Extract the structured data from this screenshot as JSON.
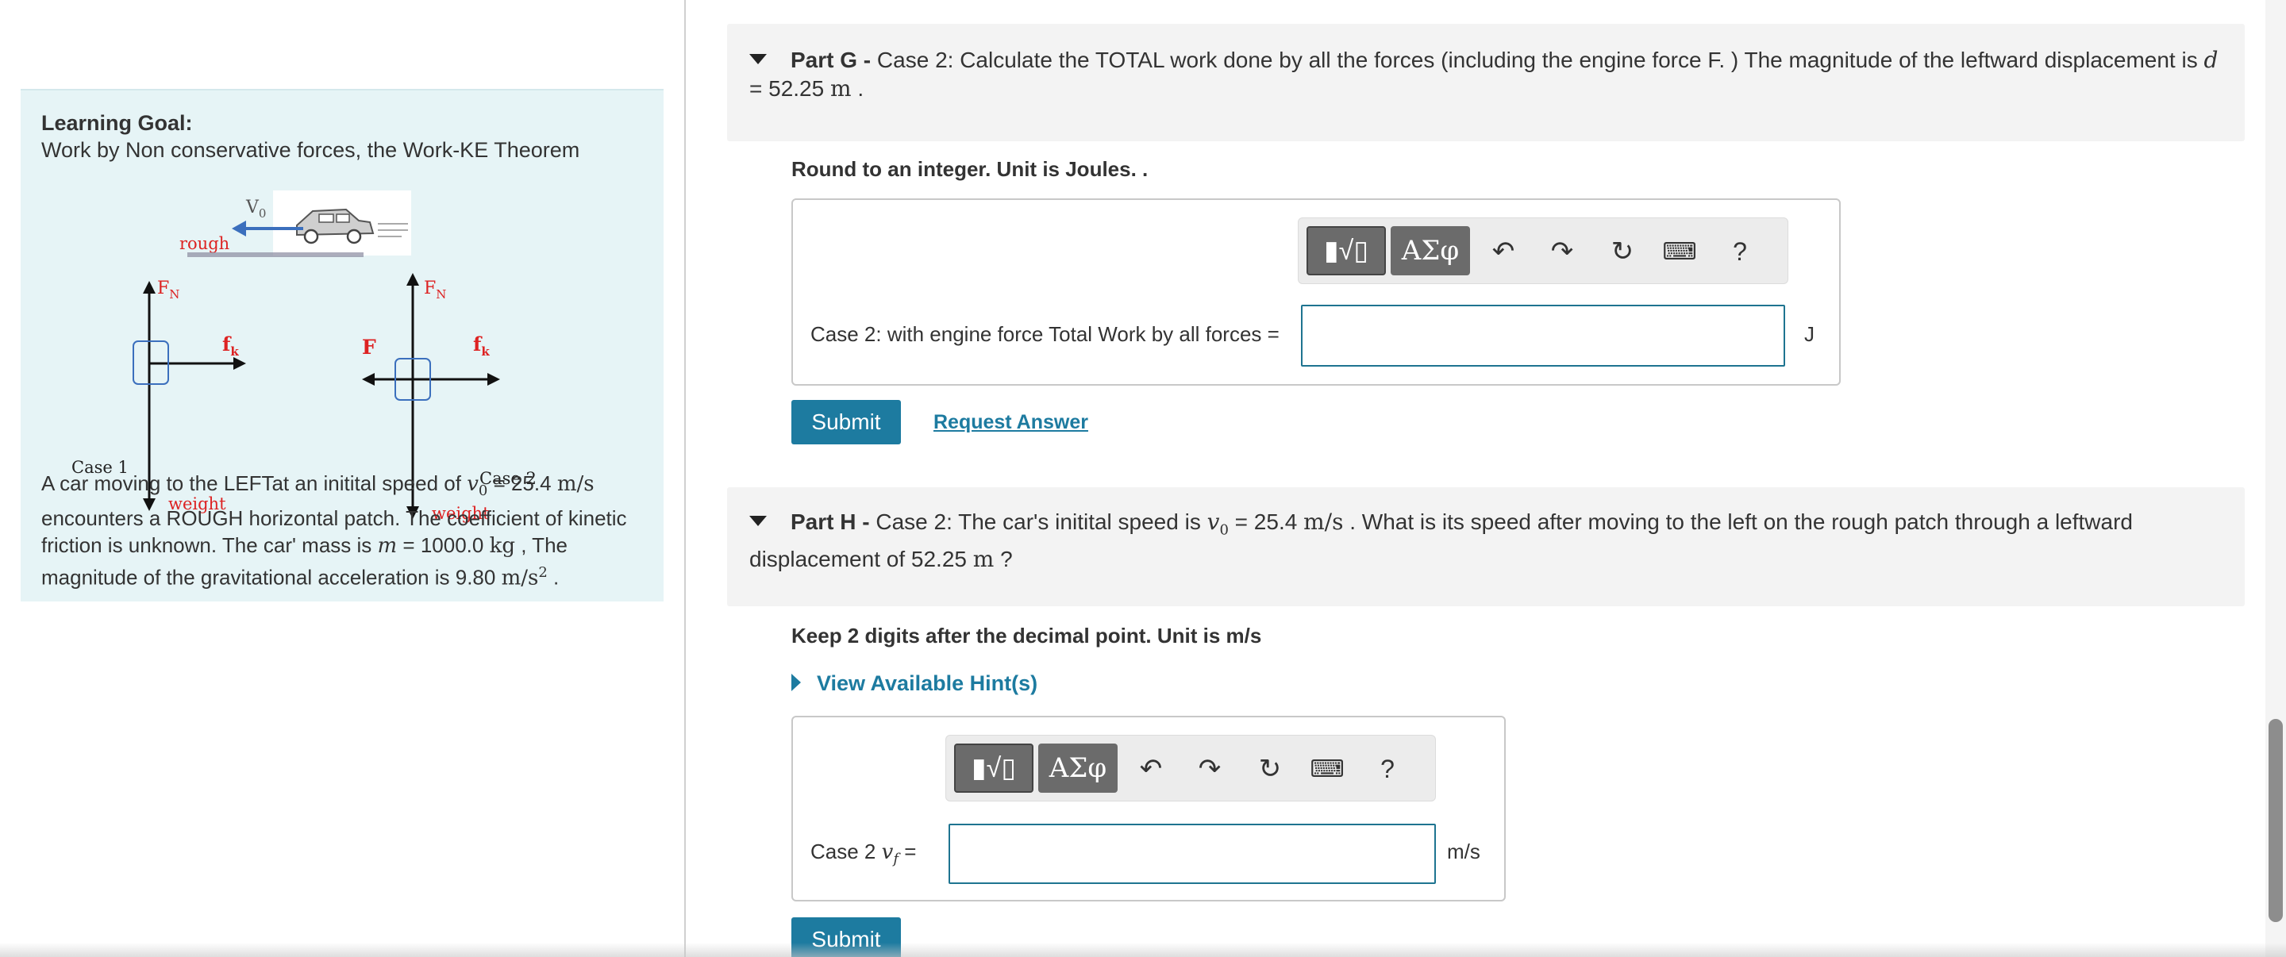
{
  "learning_goal": {
    "title": "Learning Goal:",
    "subtitle": "Work by Non conservative forces, the Work-KE Theorem",
    "diagram_labels": {
      "v0": "V",
      "v0_sub": "0",
      "rough": "rough",
      "fn": "F",
      "fn_sub": "N",
      "fk": "f",
      "fk_sub": "k",
      "F": "F",
      "weight": "weight",
      "case1": "Case 1",
      "case2": "Case 2"
    },
    "problem": {
      "t1": "A car moving to the LEFTat an initital speed of ",
      "v0_sym": "v",
      "v0_sub": "0",
      "t2": " = 25.4 ",
      "unit_ms": "m/s",
      "t3": " encounters a ROUGH horizontal patch. The coefficient of kinetic friction is unknown. The car' mass is ",
      "m_sym": "m",
      "t4": " = 1000.0 ",
      "unit_kg": "kg",
      "t5": " , The magnitude of the gravitational acceleration is 9.80 ",
      "unit_g": "m/s",
      "unit_g_exp": "2",
      "t6": " ."
    }
  },
  "part_g": {
    "label": "Part G -",
    "text": " Case 2: Calculate the TOTAL work done by all the forces (including the engine force F. ) The magnitude of the leftward displacement is ",
    "d_sym": "d",
    "line2_a": "= 52.25 ",
    "line2_unit": "m",
    "line2_b": " .",
    "instruction": "Round to an integer. Unit is Joules. .",
    "field_label": "Case 2: with engine force  Total Work by all forces =",
    "input_value": "",
    "unit": "J",
    "submit": "Submit",
    "request": "Request Answer"
  },
  "part_h": {
    "label": "Part H -",
    "text": " Case 2: The car's initital speed is ",
    "v0_sym": "v",
    "v0_sub": "0",
    "text2": " = 25.4 ",
    "unit_ms": "m/s",
    "text3": " . What is its speed after moving to the left on the rough patch through a leftward",
    "line2_a": "displacement of 52.25 ",
    "line2_unit": "m",
    "line2_b": " ?",
    "instruction": "Keep 2 digits after the decimal point. Unit is m/s",
    "hint": "View Available Hint(s)",
    "field_prefix": "Case 2 ",
    "vf_sym": "v",
    "vf_sub": "f",
    "field_eq": " =",
    "input_value": "",
    "unit": "m/s",
    "submit": "Submit"
  },
  "toolbar": {
    "greek": "ΑΣφ",
    "help": "?"
  },
  "colors": {
    "accent": "#1d7ba0",
    "goal_bg": "#e6f4f6",
    "header_bg": "#f3f3f3"
  }
}
